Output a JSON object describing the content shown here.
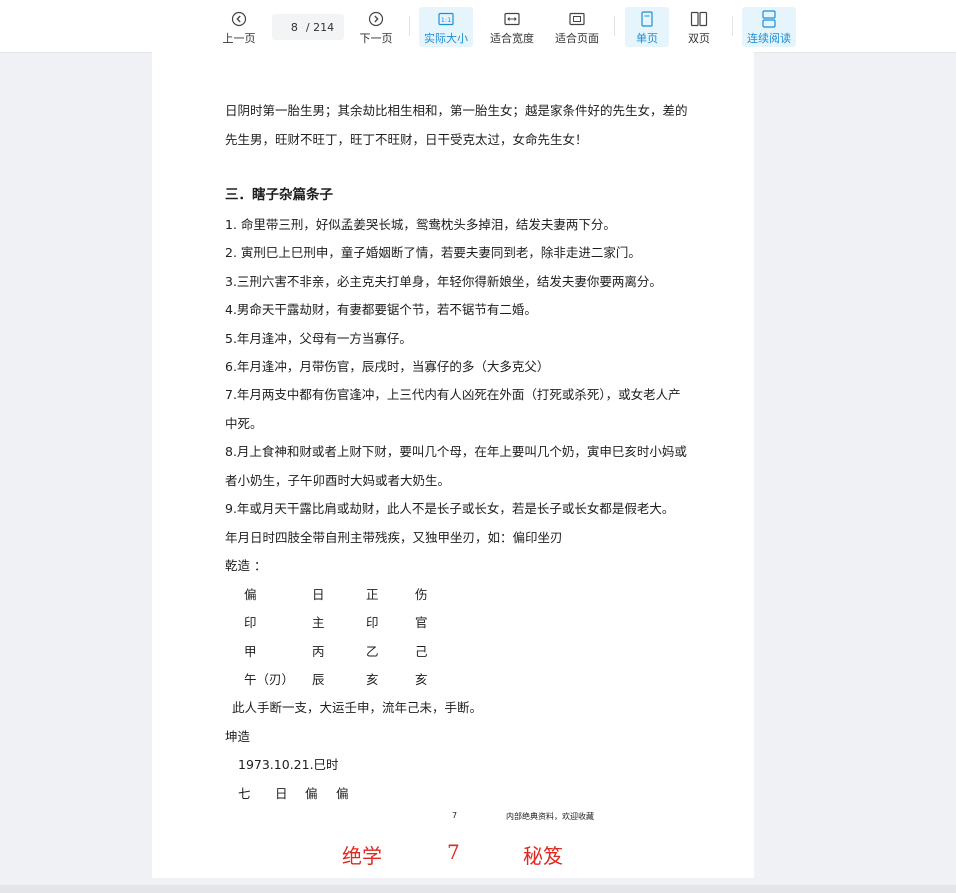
{
  "toolbar": {
    "prev_label": "上一页",
    "next_label": "下一页",
    "page_current": "8",
    "page_total": "/ 214",
    "actual_size_label": "实际大小",
    "fit_width_label": "适合宽度",
    "fit_page_label": "适合页面",
    "single_page_label": "单页",
    "double_page_label": "双页",
    "continuous_label": "连续阅读",
    "active_color": "#1b8fd6"
  },
  "document": {
    "lines": [
      "日阴时第一胎生男；其余劫比相生相和，第一胎生女；越是家条件好的先生女，差的",
      "先生男，旺财不旺丁，旺丁不旺财，日干受克太过，女命先生女！",
      "三．瞎子杂篇条子",
      "1. 命里带三刑，好似孟姜哭长城，鸳鸯枕头多掉泪，结发夫妻两下分。",
      "2. 寅刑巳上巳刑申，童子婚姻断了情，若要夫妻同到老，除非走进二家门。",
      "3.三刑六害不非亲，必主克夫打单身，年轻你得新娘坐，结发夫妻你要两离分。",
      "4.男命天干露劫财，有妻都要锯个节，若不锯节有二婚。",
      "5.年月逢冲，父母有一方当寡仔。",
      "6.年月逢冲，月带伤官，辰戌时，当寡仔的多（大多克父）",
      "7.年月两支中都有伤官逢冲，上三代内有人凶死在外面（打死或杀死），或女老人产",
      "中死。",
      "8.月上食神和财或者上财下财，要叫几个母，在年上要叫几个奶，寅申巳亥时小妈或",
      "者小奶生，子午卯酉时大妈或者大奶生。",
      "9.年或月天干露比肩或劫财，此人不是长子或长女，若是长子或长女都是假老大。",
      "年月日时四肢全带自刑主带残疾，又独甲坐刃，如：偏印坐刃",
      "乾造 ："
    ],
    "bazi1": {
      "row1": [
        "偏",
        "日",
        "正",
        "伤"
      ],
      "row2": [
        "印",
        "主",
        "印",
        "官"
      ],
      "row3": [
        "甲",
        "丙",
        "乙",
        "己"
      ],
      "row4": [
        "午（刃）",
        "辰",
        "亥",
        "亥"
      ]
    },
    "after_lines": [
      "此人手断一支，大运壬申，流年己未，手断。",
      "坤造",
      "1973.10.21.巳时"
    ],
    "bazi2": [
      "七",
      "日",
      "偏",
      "偏"
    ],
    "footer_page_num": "7",
    "footer_note": "内部绝典资料，欢迎收藏",
    "watermark": [
      "绝学",
      "7",
      "秘笈"
    ]
  }
}
